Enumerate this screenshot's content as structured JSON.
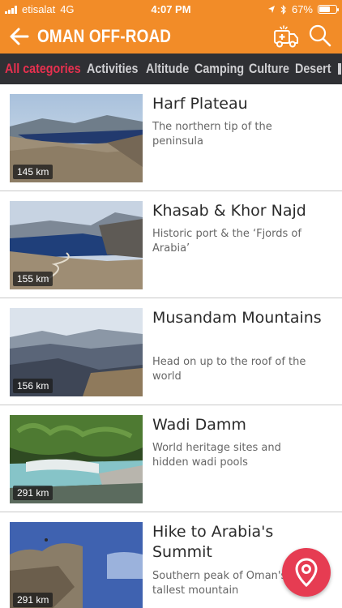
{
  "status_bar": {
    "carrier": "etisalat",
    "network": "4G",
    "time": "4:07 PM",
    "battery": "67%",
    "battery_level": 0.67
  },
  "app_bar": {
    "title": "OMAN OFF-ROAD",
    "back_icon": "arrow-left-icon",
    "ambulance_icon": "ambulance-icon",
    "search_icon": "search-icon"
  },
  "categories": [
    {
      "label": "All categories",
      "active": true
    },
    {
      "label": "Activities",
      "active": false
    },
    {
      "label": "Altitude",
      "active": false
    },
    {
      "label": "Camping",
      "active": false
    },
    {
      "label": "Culture",
      "active": false
    },
    {
      "label": "Desert",
      "active": false
    }
  ],
  "items": [
    {
      "title": "Harf Plateau",
      "subtitle": "The northern tip of the peninsula",
      "distance": "145 km"
    },
    {
      "title": "Khasab & Khor Najd",
      "subtitle": "Historic port & the ‘Fjords of Arabia’",
      "distance": "155 km"
    },
    {
      "title": "Musandam Mountains",
      "subtitle": "Head on up to the roof of the world",
      "distance": "156 km"
    },
    {
      "title": "Wadi Damm",
      "subtitle": "World heritage sites and hidden wadi pools",
      "distance": "291 km"
    },
    {
      "title": "Hike to Arabia's Summit",
      "subtitle": "Southern peak of Oman's tallest mountain",
      "distance": "291 km"
    }
  ],
  "fab": {
    "icon": "map-pin-icon"
  },
  "colors": {
    "brand_orange": "#f28c28",
    "category_bar": "#2f3034",
    "active_category": "#e8304f",
    "fab_red": "#e63c52"
  }
}
